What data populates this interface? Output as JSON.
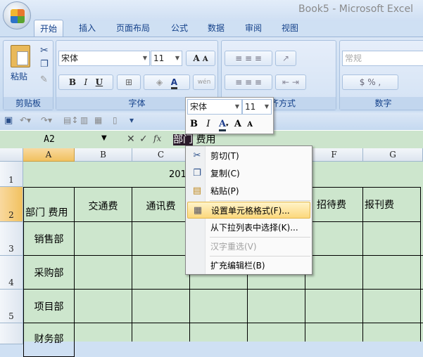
{
  "window": {
    "title": "Book5 - Microsoft Excel"
  },
  "tabs": [
    "开始",
    "插入",
    "页面布局",
    "公式",
    "数据",
    "审阅",
    "视图"
  ],
  "ribbon": {
    "clipboard": {
      "label": "剪贴板",
      "paste": "粘贴"
    },
    "font": {
      "label": "字体",
      "name": "宋体",
      "size": "11",
      "bold": "B",
      "italic": "I",
      "underline": "U",
      "grow": "A",
      "shrink": "A",
      "color": "A",
      "phonetic": "wén"
    },
    "alignment": {
      "label": "对齐方式"
    },
    "number": {
      "label": "数字",
      "format": "常规",
      "percent": "%",
      "comma": ","
    }
  },
  "formula_bar": {
    "name_box": "A2",
    "fx": "fx",
    "selected_text": "部门",
    "rest_text": " 费用"
  },
  "columns": [
    "A",
    "B",
    "C",
    "D",
    "E",
    "F",
    "G"
  ],
  "rows": [
    "1",
    "2",
    "3",
    "4",
    "5"
  ],
  "cells": {
    "title_fragment": "201",
    "header": [
      "部门 费用",
      "交通费",
      "通讯费",
      "",
      "",
      "招待费",
      "报刊费"
    ],
    "departments": [
      "销售部",
      "采购部",
      "项目部",
      "财务部"
    ]
  },
  "mini_toolbar": {
    "font": "宋体",
    "size": "11",
    "bold": "B",
    "italic": "I",
    "color": "A",
    "grow": "A",
    "shrink": "A"
  },
  "context_menu": [
    {
      "label": "剪切(T)",
      "icon": "scissors-icon"
    },
    {
      "label": "复制(C)",
      "icon": "copy-icon"
    },
    {
      "label": "粘贴(P)",
      "icon": "paste-icon"
    },
    {
      "label": "设置单元格格式(F)...",
      "icon": "format-cells-icon",
      "highlighted": true
    },
    {
      "label": "从下拉列表中选择(K)..."
    },
    {
      "label": "汉字重选(V)",
      "disabled": true
    },
    {
      "label": "扩充编辑栏(B)"
    }
  ]
}
